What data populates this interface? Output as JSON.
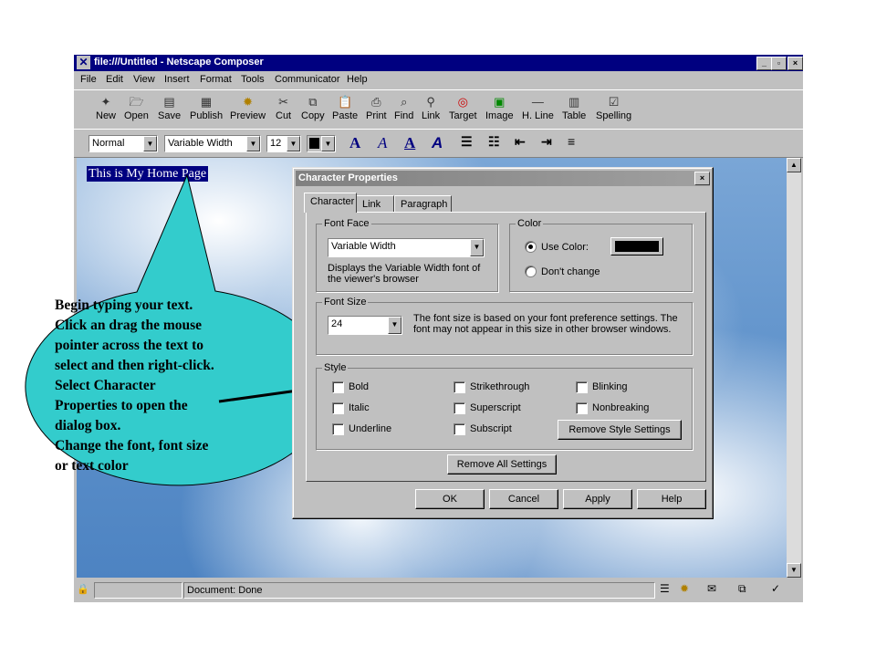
{
  "window": {
    "title": "file:///Untitled - Netscape Composer"
  },
  "menu": [
    "File",
    "Edit",
    "View",
    "Insert",
    "Format",
    "Tools",
    "Communicator",
    "Help"
  ],
  "toolbar": [
    "New",
    "Open",
    "Save",
    "Publish",
    "Preview",
    "Cut",
    "Copy",
    "Paste",
    "Print",
    "Find",
    "Link",
    "Target",
    "Image",
    "H. Line",
    "Table",
    "Spelling"
  ],
  "format": {
    "paragraph": "Normal",
    "font": "Variable Width",
    "size": "12"
  },
  "document": {
    "heading": "This is My Home Page"
  },
  "status": {
    "text": "Document: Done"
  },
  "dialog": {
    "title": "Character Properties",
    "tabs": [
      "Character",
      "Link",
      "Paragraph"
    ],
    "font_face": {
      "label": "Font Face",
      "value": "Variable Width",
      "desc1": "Displays the Variable Width font of",
      "desc2": "the viewer's browser"
    },
    "color": {
      "label": "Color",
      "use": "Use Color:",
      "dont": "Don't change",
      "value": "#000000"
    },
    "font_size": {
      "label": "Font Size",
      "value": "24",
      "desc1": "The font size is based on your font preference settings. The",
      "desc2": "font may not appear in this size in other browser windows."
    },
    "style": {
      "label": "Style",
      "bold": "Bold",
      "italic": "Italic",
      "underline": "Underline",
      "strike": "Strikethrough",
      "super": "Superscript",
      "sub": "Subscript",
      "blink": "Blinking",
      "nobreak": "Nonbreaking",
      "remove_style": "Remove Style Settings"
    },
    "remove_all": "Remove All Settings",
    "buttons": {
      "ok": "OK",
      "cancel": "Cancel",
      "apply": "Apply",
      "help": "Help"
    }
  },
  "callout": {
    "lines": [
      "Begin typing your text.",
      "Click an drag the mouse",
      "pointer across the text to",
      "select and then right-click.",
      "Select Character",
      "Properties to open the",
      "dialog box.",
      "Change the font, font size",
      "or text color"
    ]
  }
}
